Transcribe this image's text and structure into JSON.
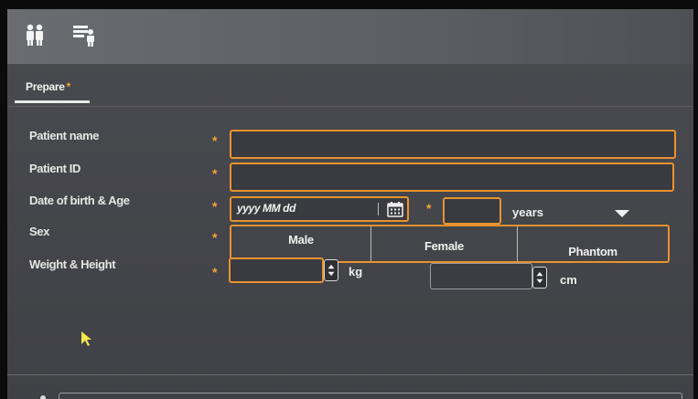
{
  "toolbar": {
    "icons": [
      "patients-icon",
      "worklist-icon"
    ]
  },
  "tabs": [
    {
      "label": "Prepare",
      "required_mark": "*",
      "active": true
    }
  ],
  "form": {
    "required_mark": "*",
    "patient_name": {
      "label": "Patient name",
      "value": ""
    },
    "patient_id": {
      "label": "Patient ID",
      "value": ""
    },
    "dob_age": {
      "label": "Date of birth & Age",
      "date_placeholder": "yyyy MM dd",
      "age_value": "",
      "age_unit": "years"
    },
    "sex": {
      "label": "Sex",
      "options": [
        "Male",
        "Female",
        "Phantom"
      ],
      "selected": ""
    },
    "weight_height": {
      "label": "Weight & Height",
      "weight_value": "",
      "weight_unit": "kg",
      "height_value": "",
      "height_unit": "cm"
    }
  },
  "colors": {
    "accent": "#e9922f",
    "required": "#f5a23a",
    "background": "#46474c"
  }
}
